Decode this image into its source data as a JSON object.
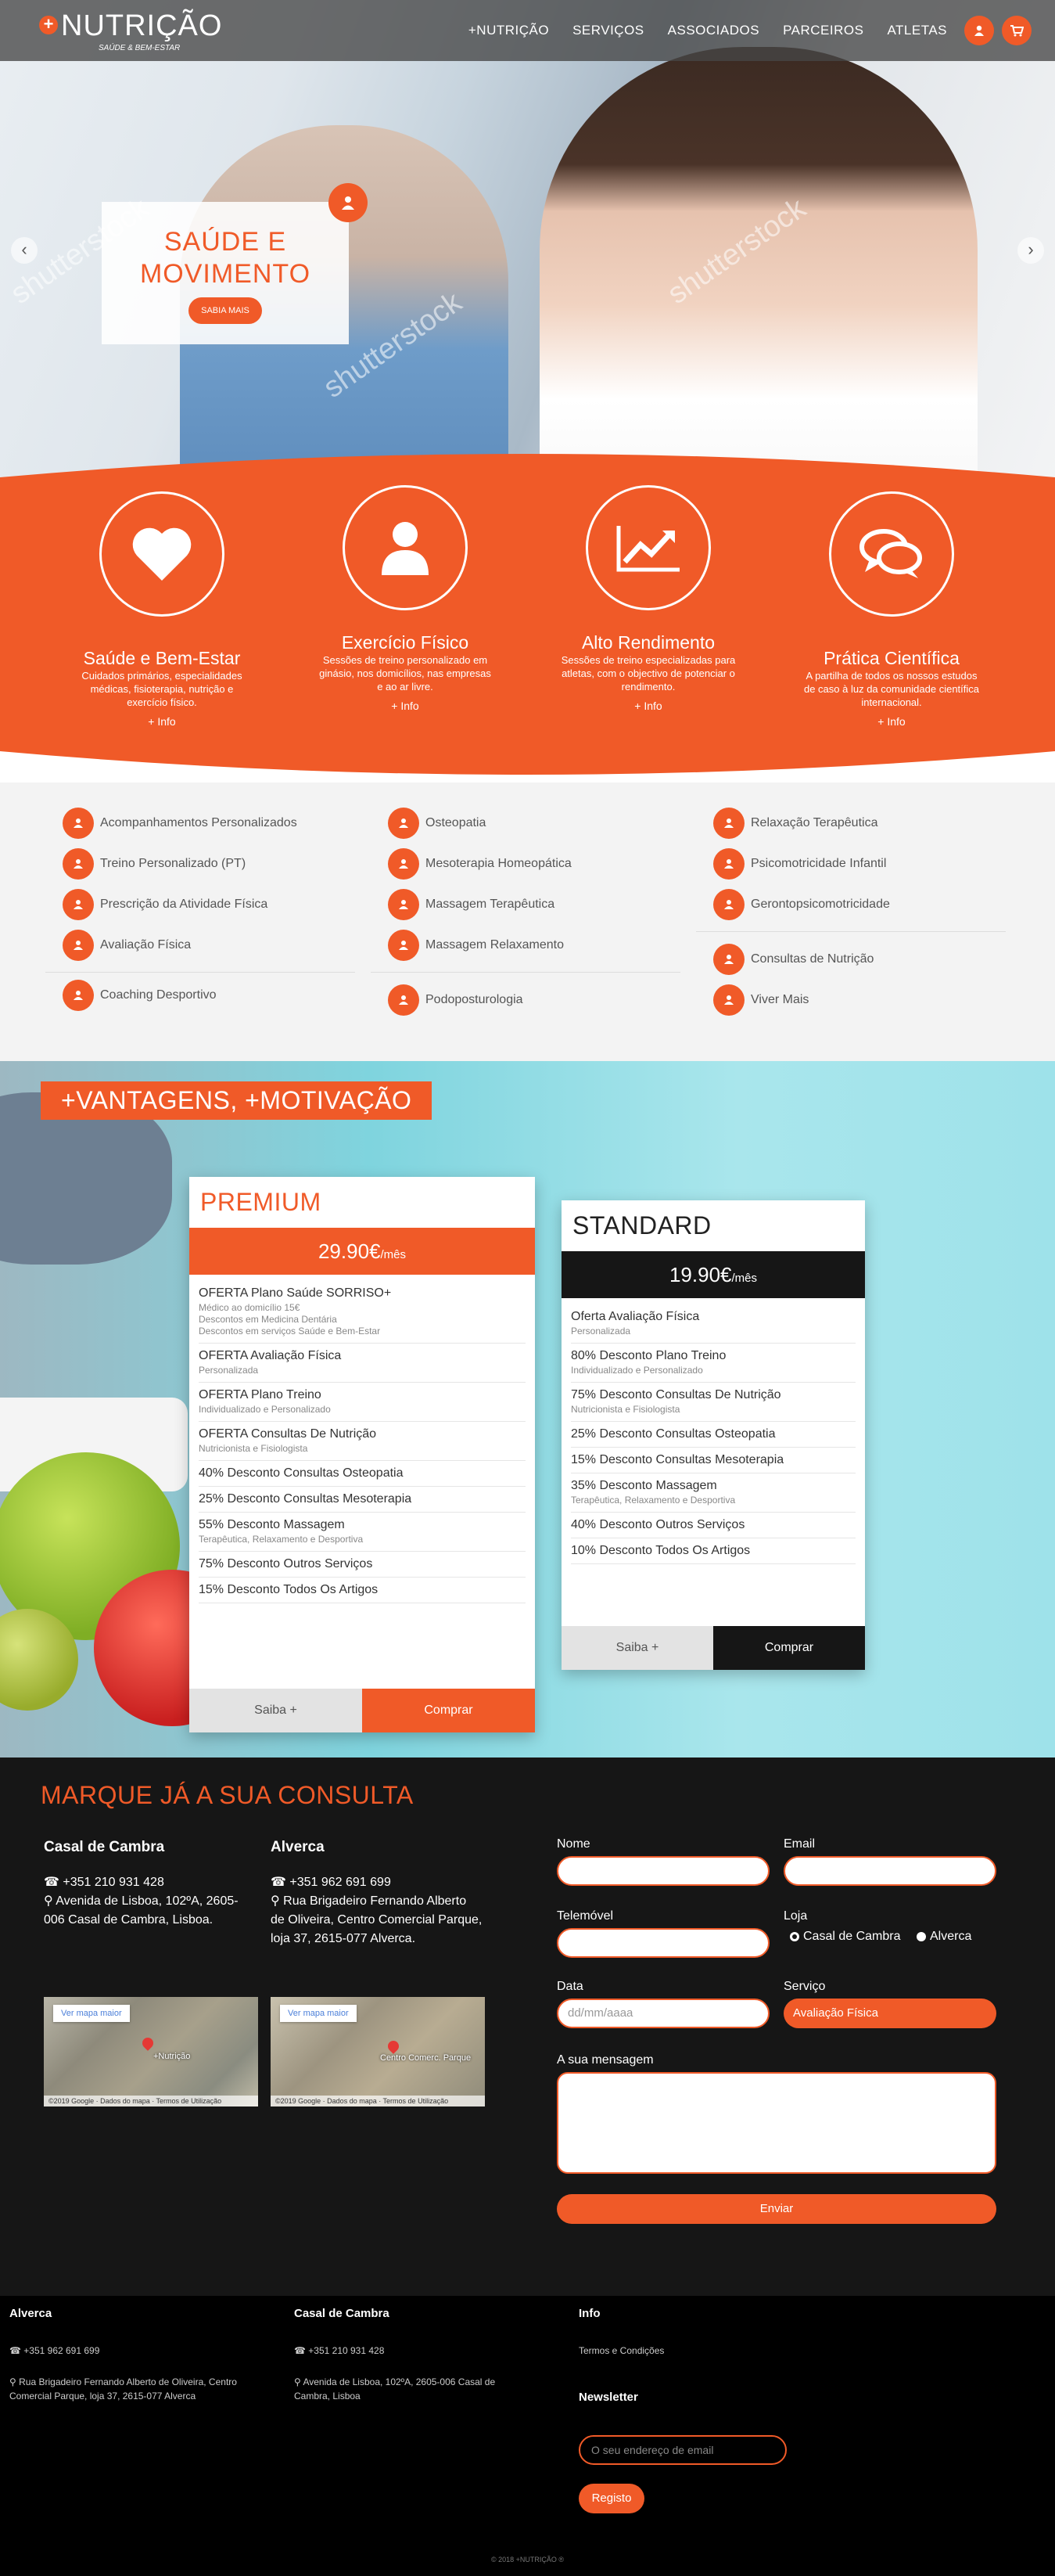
{
  "header": {
    "logo_text": "NUTRIÇÃO",
    "logo_tagline": "SAÚDE & BEM-ESTAR",
    "nav": [
      "+NUTRIÇÃO",
      "SERVIÇOS",
      "ASSOCIADOS",
      "PARCEIROS",
      "ATLETAS"
    ],
    "icons": [
      "user-icon",
      "cart-icon"
    ]
  },
  "hero": {
    "title_line1": "SAÚDE E",
    "title_line2": "MOVIMENTO",
    "button": "SABIA MAIS",
    "watermark": "shutterstock",
    "prev": "‹",
    "next": "›"
  },
  "features": [
    {
      "icon": "heart-icon",
      "title": "Saúde e Bem-Estar",
      "desc": "Cuidados primários, especialidades médicas, fisioterapia, nutrição e exercício físico.",
      "link": "+ Info"
    },
    {
      "icon": "person-icon",
      "title": "Exercício Físico",
      "desc": "Sessões de treino personalizado em ginásio, nos domicílios, nas empresas e ao ar livre.",
      "link": "+ Info"
    },
    {
      "icon": "chart-icon",
      "title": "Alto Rendimento",
      "desc": "Sessões de treino especializadas para atletas, com o objectivo de potenciar o rendimento.",
      "link": "+ Info"
    },
    {
      "icon": "chat-icon",
      "title": "Prática Científica",
      "desc": "A partilha de todos os nossos estudos de caso à luz da comunidade científica internacional.",
      "link": "+ Info"
    }
  ],
  "services": {
    "col1": [
      "Acompanhamentos Personalizados",
      "Treino Personalizado (PT)",
      "Prescrição da Atividade Física",
      "Avaliação Física",
      "Coaching Desportivo"
    ],
    "col2": [
      "Osteopatia",
      "Mesoterapia Homeopática",
      "Massagem Terapêutica",
      "Massagem Relaxamento",
      "Podoposturologia"
    ],
    "col3": [
      "Relaxação Terapêutica",
      "Psicomotricidade Infantil",
      "Gerontopsicomotricidade",
      "Consultas de Nutrição",
      "Viver Mais"
    ]
  },
  "vantagens": {
    "title": "+VANTAGENS, +MOTIVAÇÃO",
    "premium": {
      "name": "PREMIUM",
      "price": "29.90€",
      "per": "/mês",
      "rows": [
        {
          "a": "OFERTA Plano Saúde SORRISO+",
          "b": "Médico ao domicílio 15€\nDescontos em Medicina Dentária\nDescontos em serviços Saúde e Bem-Estar"
        },
        {
          "a": "OFERTA Avaliação Física",
          "b": "Personalizada"
        },
        {
          "a": "OFERTA Plano Treino",
          "b": "Individualizado e Personalizado"
        },
        {
          "a": "OFERTA Consultas De Nutrição",
          "b": "Nutricionista e Fisiologista"
        },
        {
          "a": "40% Desconto Consultas Osteopatia",
          "b": ""
        },
        {
          "a": "25% Desconto Consultas Mesoterapia",
          "b": ""
        },
        {
          "a": "55% Desconto Massagem",
          "b": "Terapêutica, Relaxamento e Desportiva"
        },
        {
          "a": "75% Desconto Outros Serviços",
          "b": ""
        },
        {
          "a": "15% Desconto Todos Os Artigos",
          "b": ""
        }
      ],
      "more": "Saiba +",
      "buy": "Comprar"
    },
    "standard": {
      "name": "STANDARD",
      "price": "19.90€",
      "per": "/mês",
      "rows": [
        {
          "a": "Oferta Avaliação Física",
          "b": "Personalizada"
        },
        {
          "a": "80% Desconto Plano Treino",
          "b": "Individualizado e Personalizado"
        },
        {
          "a": "75% Desconto Consultas De Nutrição",
          "b": "Nutricionista e Fisiologista"
        },
        {
          "a": "25% Desconto Consultas Osteopatia",
          "b": ""
        },
        {
          "a": "15% Desconto Consultas Mesoterapia",
          "b": ""
        },
        {
          "a": "35% Desconto Massagem",
          "b": "Terapêutica, Relaxamento e Desportiva"
        },
        {
          "a": "40% Desconto Outros Serviços",
          "b": ""
        },
        {
          "a": "10% Desconto Todos Os Artigos",
          "b": ""
        }
      ],
      "more": "Saiba +",
      "buy": "Comprar"
    }
  },
  "consulta": {
    "title": "MARQUE JÁ A SUA CONSULTA",
    "shops": [
      {
        "name": "Casal de Cambra",
        "phone": "+351 210 931 428",
        "address": "Avenida de Lisboa, 102ºA, 2605-006 Casal de Cambra, Lisboa.",
        "map_btn": "Ver mapa maior",
        "map_label": "+Nutrição",
        "map_footer": "©2019 Google · Dados do mapa · Termos de Utilização"
      },
      {
        "name": "Alverca",
        "phone": "+351 962 691 699",
        "address": "Rua Brigadeiro Fernando Alberto de Oliveira, Centro Comercial Parque, loja 37, 2615-077 Alverca.",
        "map_btn": "Ver mapa maior",
        "map_label": "Centro Comerc. Parque",
        "map_footer": "©2019 Google · Dados do mapa · Termos de Utilização"
      }
    ],
    "form": {
      "nome_label": "Nome",
      "email_label": "Email",
      "telemovel_label": "Telemóvel",
      "loja_label": "Loja",
      "loja_options": [
        "Casal de Cambra",
        "Alverca"
      ],
      "data_label": "Data",
      "data_placeholder": "dd/mm/aaaa",
      "servico_label": "Serviço",
      "servico_value": "Avaliação Física",
      "mensagem_label": "A sua mensagem",
      "enviar": "Enviar"
    }
  },
  "footer": {
    "cols": [
      {
        "title": "Alverca",
        "phone": "+351 962 691 699",
        "address": "Rua Brigadeiro Fernando Alberto de Oliveira, Centro Comercial Parque, loja 37, 2615-077 Alverca"
      },
      {
        "title": "Casal de Cambra",
        "phone": "+351 210 931 428",
        "address": "Avenida de Lisboa, 102ºA, 2605-006 Casal de Cambra, Lisboa"
      }
    ],
    "info_title": "Info",
    "info_link": "Termos e Condições",
    "newsletter_title": "Newsletter",
    "newsletter_placeholder": "O seu endereço de email",
    "newsletter_button": "Registo",
    "copyright": "© 2018 +NUTRIÇÃO ®"
  },
  "colors": {
    "accent": "#f05a28",
    "dark": "#161616"
  }
}
